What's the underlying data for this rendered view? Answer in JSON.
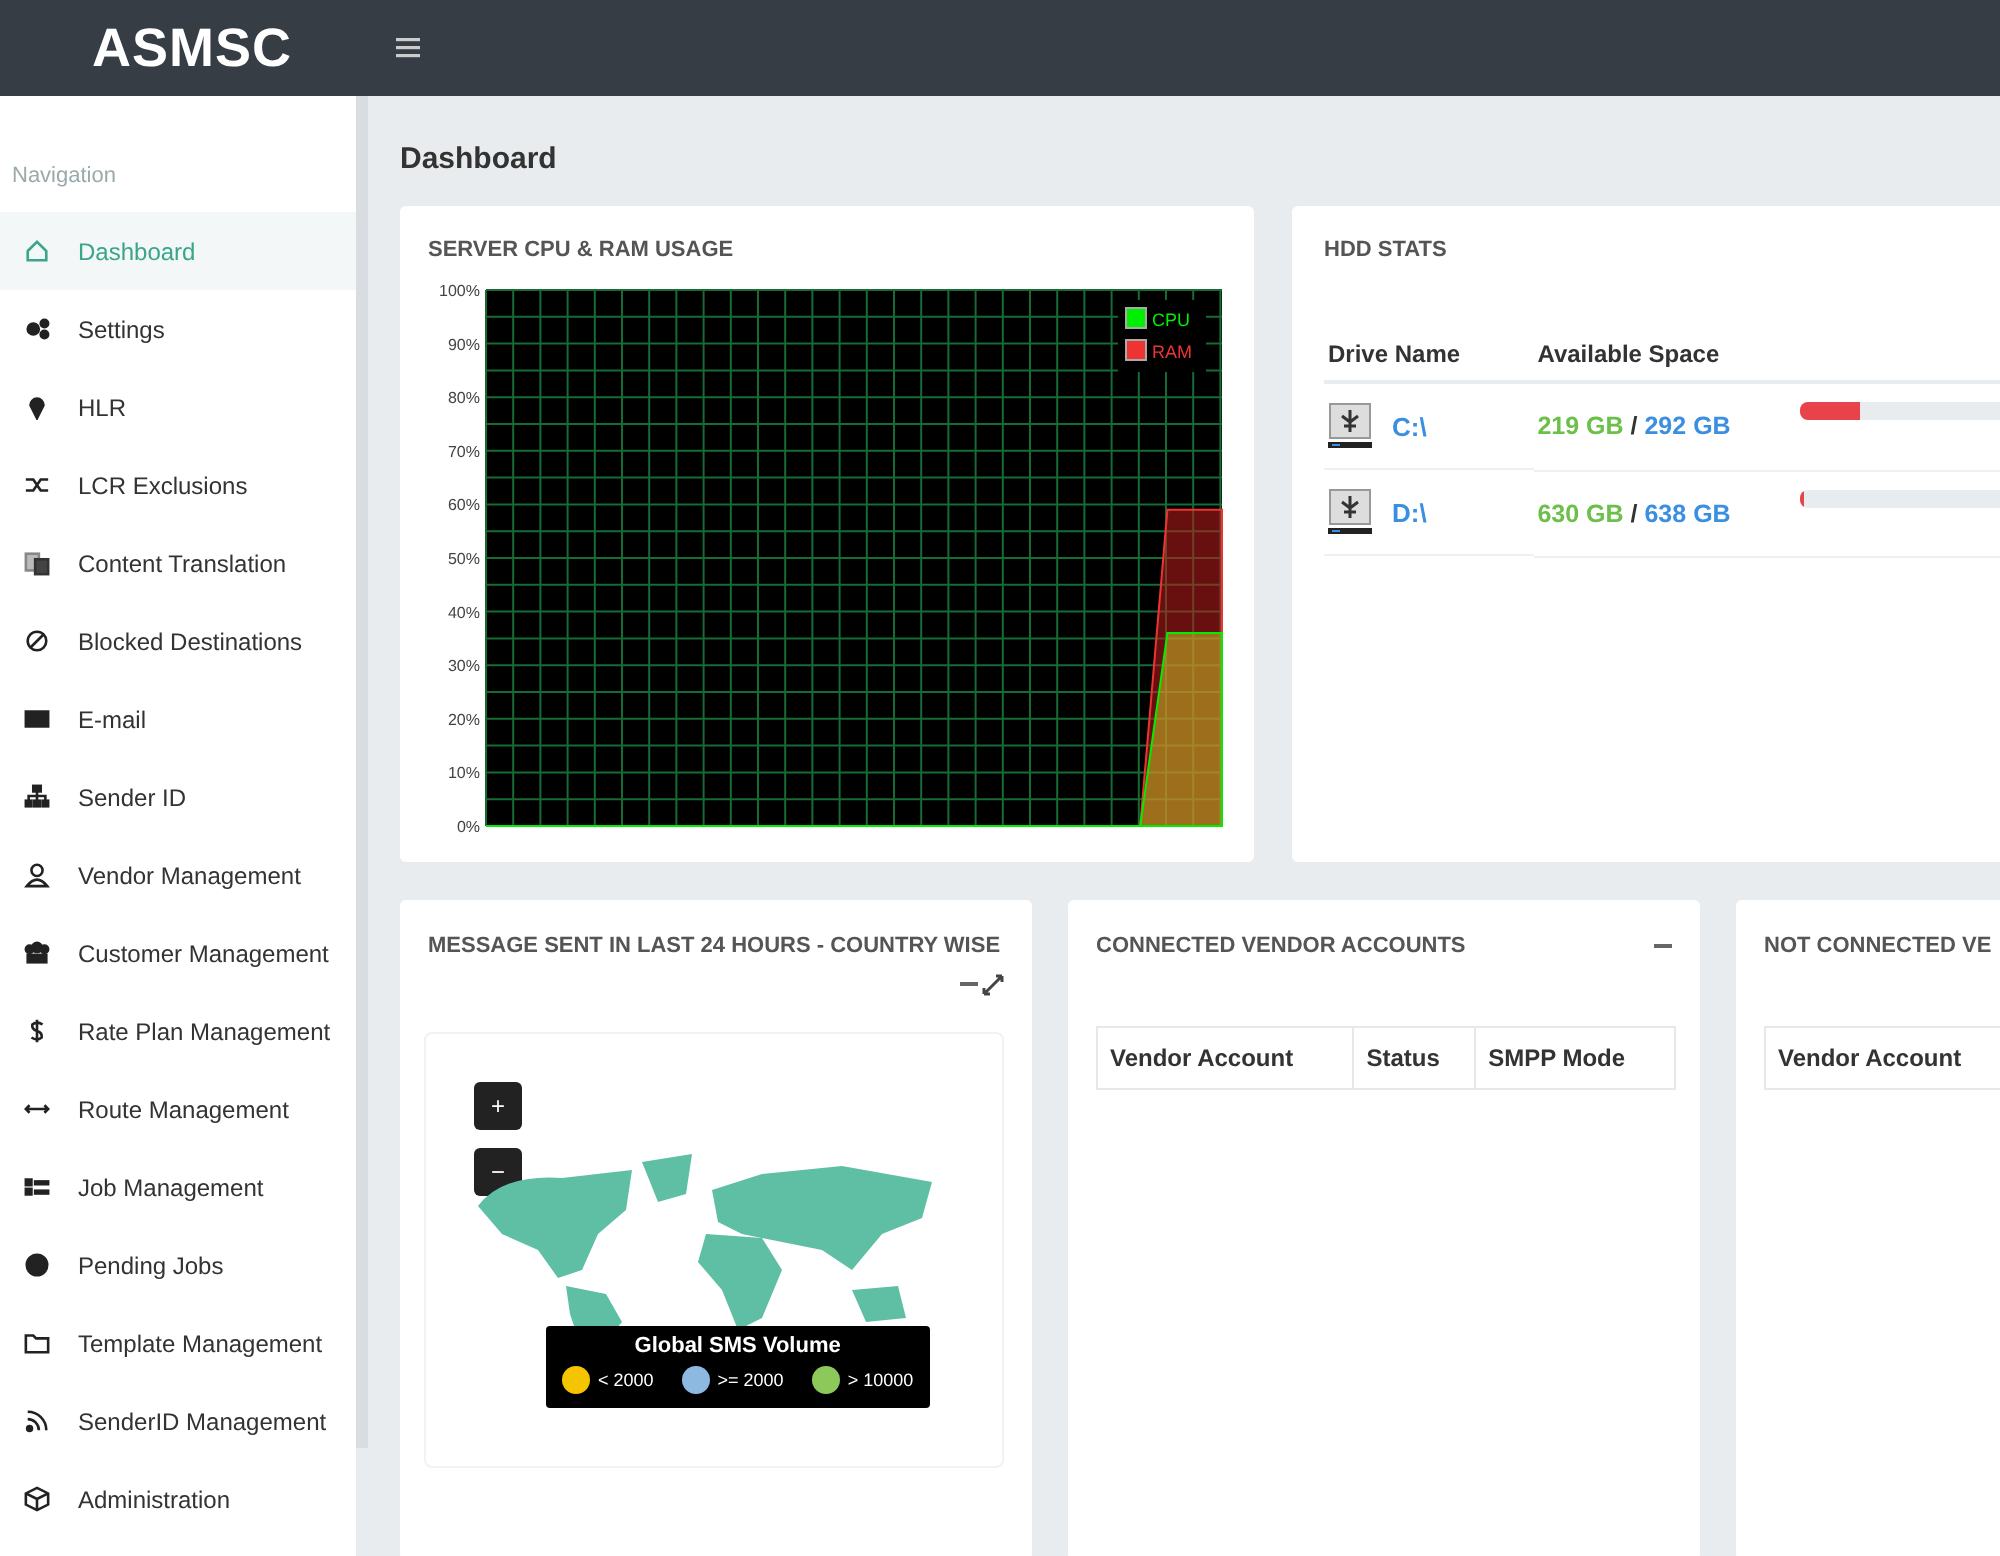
{
  "header": {
    "logo": "ASMSC"
  },
  "sidebar": {
    "heading": "Navigation",
    "items": [
      {
        "label": "Dashboard",
        "selected": true
      },
      {
        "label": "Settings",
        "selected": false
      },
      {
        "label": "HLR",
        "selected": false
      },
      {
        "label": "LCR Exclusions",
        "selected": false
      },
      {
        "label": "Content Translation",
        "selected": false
      },
      {
        "label": "Blocked Destinations",
        "selected": false
      },
      {
        "label": "E-mail",
        "selected": false
      },
      {
        "label": "Sender ID",
        "selected": false
      },
      {
        "label": "Vendor Management",
        "selected": false
      },
      {
        "label": "Customer Management",
        "selected": false
      },
      {
        "label": "Rate Plan Management",
        "selected": false
      },
      {
        "label": "Route Management",
        "selected": false
      },
      {
        "label": "Job Management",
        "selected": false
      },
      {
        "label": "Pending Jobs",
        "selected": false
      },
      {
        "label": "Template Management",
        "selected": false
      },
      {
        "label": "SenderID Management",
        "selected": false
      },
      {
        "label": "Administration",
        "selected": false
      }
    ]
  },
  "page_title": "Dashboard",
  "usage_card": {
    "title": "SERVER CPU & RAM USAGE",
    "chart_data": {
      "type": "area",
      "grid": true,
      "ylim": [
        0,
        100
      ],
      "yticks": [
        {
          "value": 0,
          "label": "0%"
        },
        {
          "value": 10,
          "label": "10%"
        },
        {
          "value": 20,
          "label": "20%"
        },
        {
          "value": 30,
          "label": "30%"
        },
        {
          "value": 40,
          "label": "40%"
        },
        {
          "value": 50,
          "label": "50%"
        },
        {
          "value": 60,
          "label": "60%"
        },
        {
          "value": 70,
          "label": "70%"
        },
        {
          "value": 80,
          "label": "80%"
        },
        {
          "value": 90,
          "label": "90%"
        },
        {
          "value": 100,
          "label": "100%"
        }
      ],
      "series": [
        {
          "name": "CPU",
          "color": "#00ee00",
          "values": [
            0,
            0,
            0,
            0,
            0,
            0,
            0,
            0,
            0,
            0,
            0,
            0,
            0,
            0,
            0,
            0,
            0,
            0,
            0,
            0,
            0,
            0,
            0,
            0,
            0,
            36,
            36,
            36
          ]
        },
        {
          "name": "RAM",
          "color": "#ee3333",
          "values": [
            0,
            0,
            0,
            0,
            0,
            0,
            0,
            0,
            0,
            0,
            0,
            0,
            0,
            0,
            0,
            0,
            0,
            0,
            0,
            0,
            0,
            0,
            0,
            0,
            0,
            59,
            59,
            59
          ]
        }
      ]
    }
  },
  "hdd_card": {
    "title": "HDD STATS",
    "columns": [
      "Drive Name",
      "Available Space"
    ],
    "rows": [
      {
        "drive": "C:\\",
        "free": "219 GB",
        "separator": "/",
        "total": "292 GB",
        "level": 0.25
      },
      {
        "drive": "D:\\",
        "free": "630 GB",
        "separator": "/",
        "total": "638 GB",
        "level": 0.02
      }
    ]
  },
  "map_card": {
    "title": "MESSAGE SENT IN LAST 24 HOURS - COUNTRY WISE",
    "zoom_in": "+",
    "zoom_out": "−",
    "legend": {
      "title": "Global SMS Volume",
      "items": [
        {
          "label": "< 2000",
          "color": "#f5c400"
        },
        {
          "label": ">= 2000",
          "color": "#8db8e0"
        },
        {
          "label": "> 10000",
          "color": "#8cc85a"
        }
      ]
    }
  },
  "connected_card": {
    "title": "CONNECTED VENDOR ACCOUNTS",
    "columns": [
      "Vendor Account",
      "Status",
      "SMPP Mode"
    ]
  },
  "not_connected_card": {
    "title": "NOT CONNECTED VE",
    "columns": [
      "Vendor Account"
    ]
  }
}
